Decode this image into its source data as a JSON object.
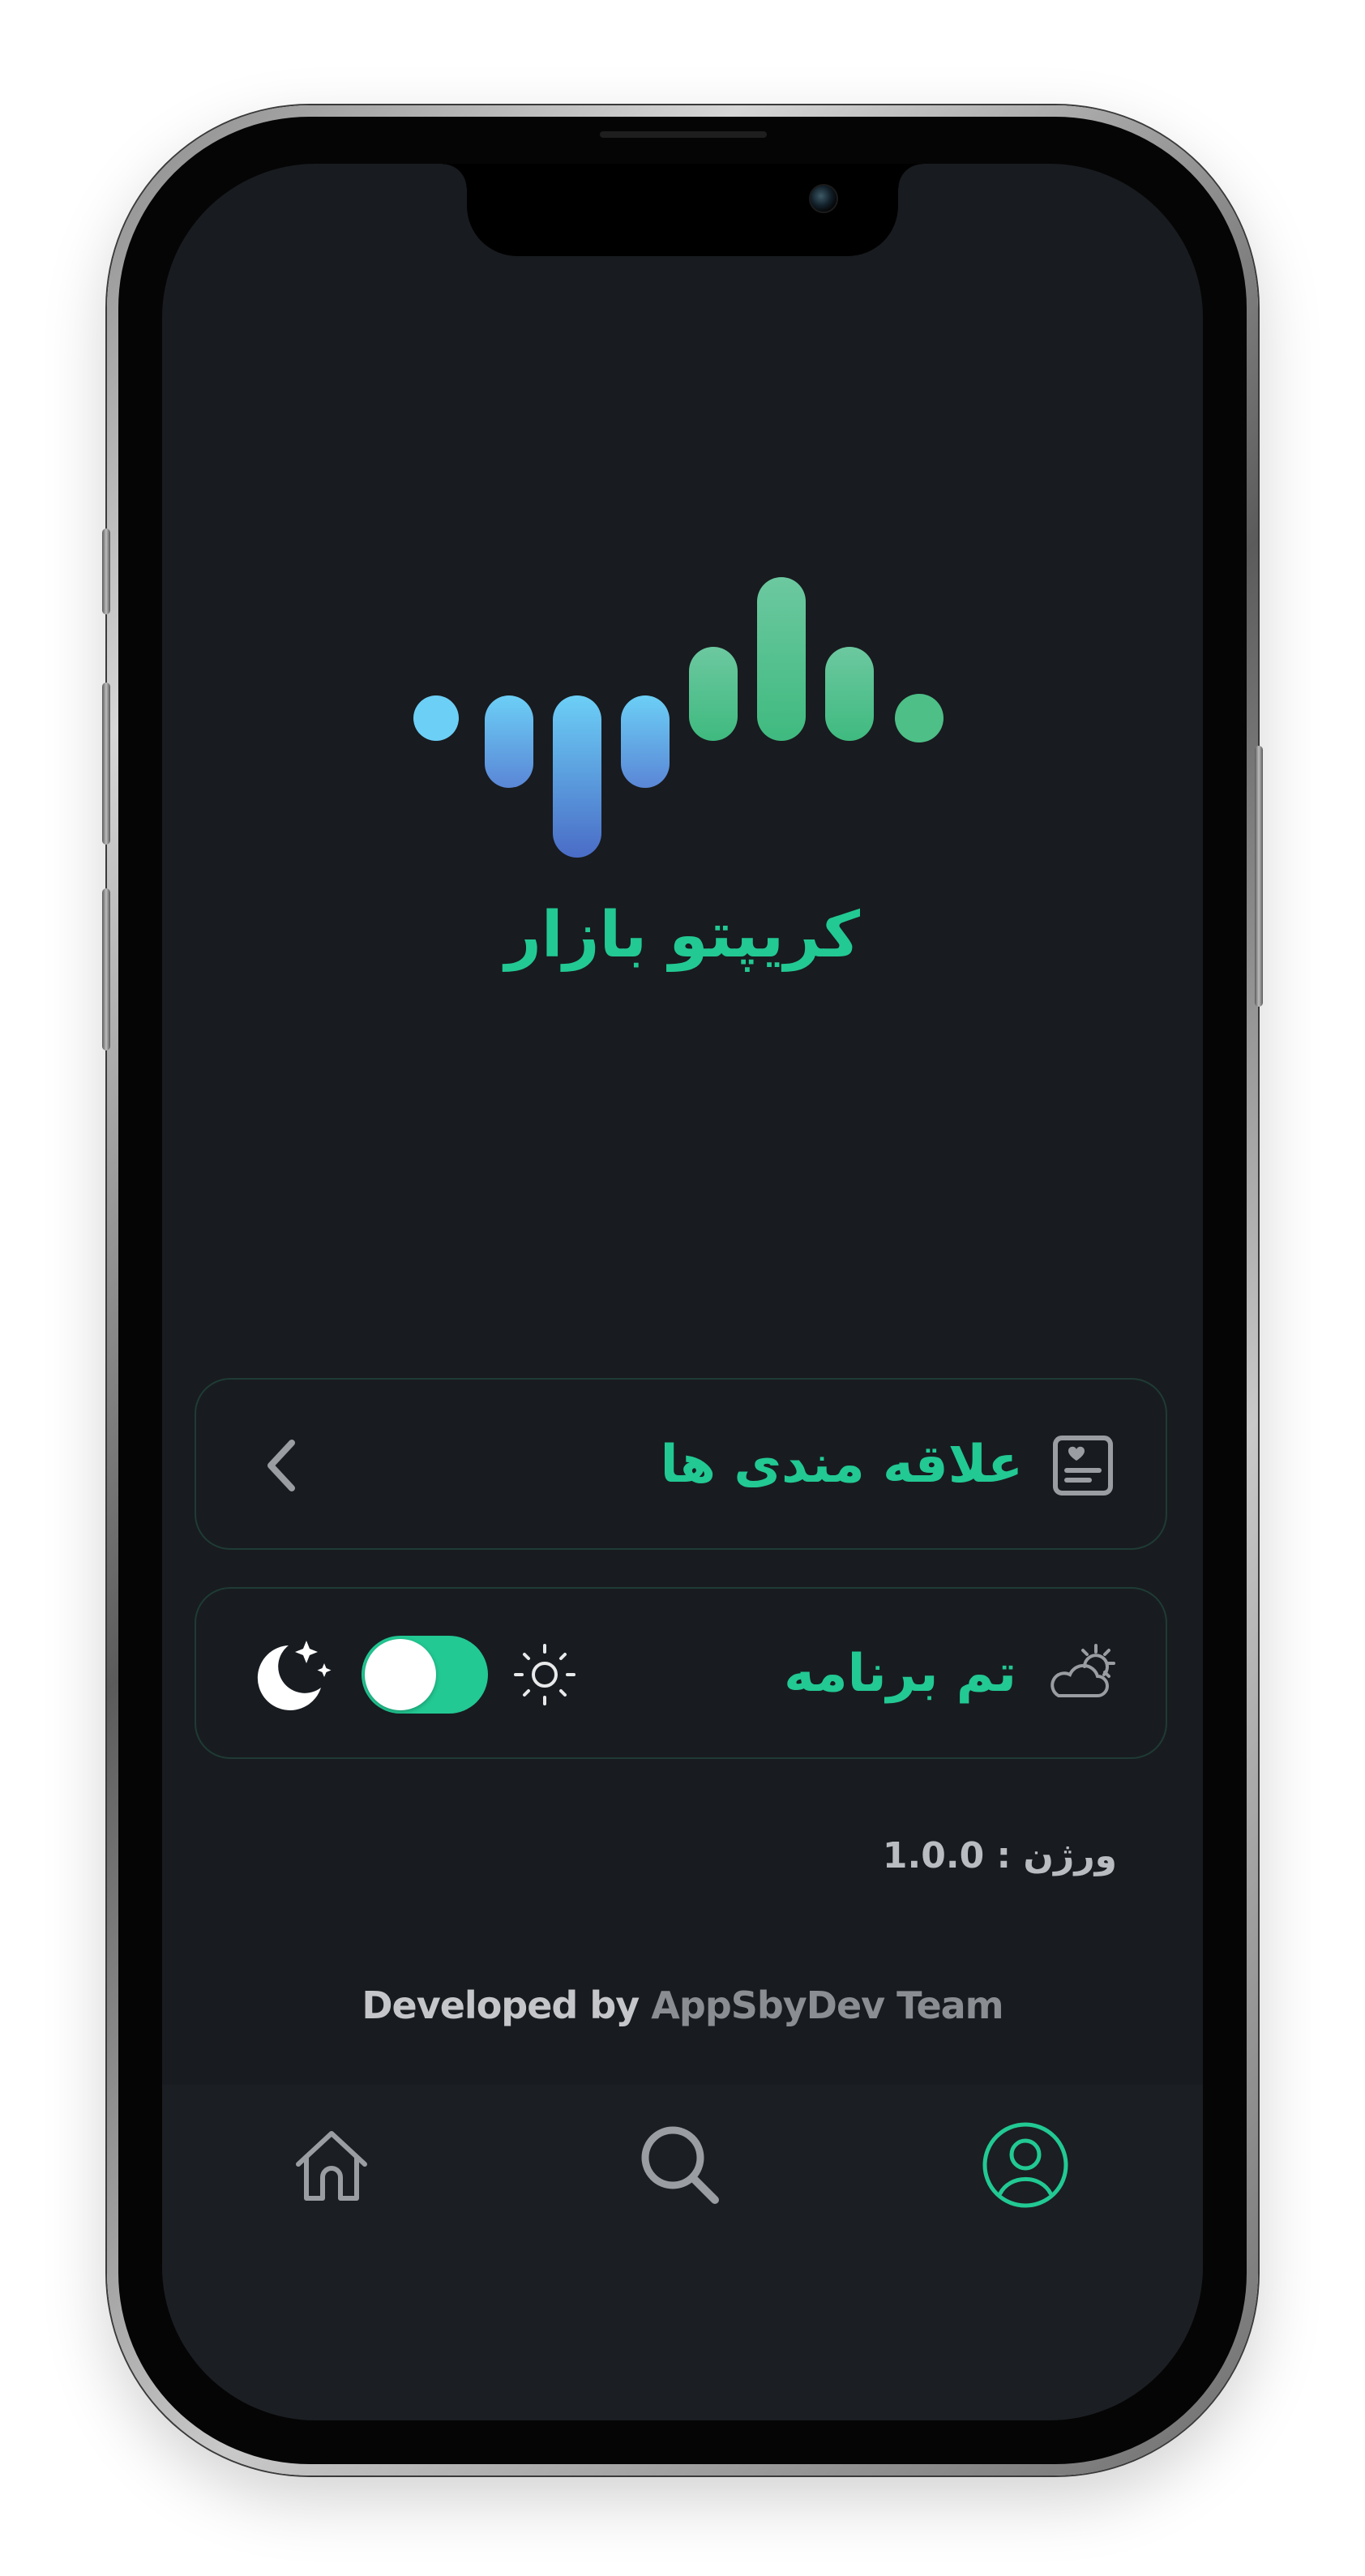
{
  "app": {
    "brand_name": "کریپتو بازار",
    "accent_color": "#22c993",
    "background_color": "#181b1f",
    "logo": {
      "name": "equalizer-bars-logo",
      "colors": [
        "#6ccff6",
        "#4a7bd0",
        "#3fbf85",
        "#6cc8a0"
      ]
    }
  },
  "settings": {
    "favorites": {
      "label": "علاقه مندی ها",
      "icon": "favorites-list-icon",
      "action_icon": "chevron-left-icon"
    },
    "theme": {
      "label": "تم برنامه",
      "icon": "weather-icon",
      "light_icon": "sun-icon",
      "dark_icon": "moon-stars-icon",
      "dark_mode_enabled": true
    }
  },
  "version": {
    "text": "ورژن : 1.0.0"
  },
  "footer": {
    "prefix": "Developed by ",
    "team": "AppSbyDev Team"
  },
  "bottom_nav": {
    "items": [
      {
        "name": "home",
        "icon": "home-icon",
        "active": false
      },
      {
        "name": "search",
        "icon": "search-icon",
        "active": false
      },
      {
        "name": "profile",
        "icon": "profile-icon",
        "active": true
      }
    ],
    "active_color": "#22c993",
    "inactive_color": "#9a9da2"
  }
}
